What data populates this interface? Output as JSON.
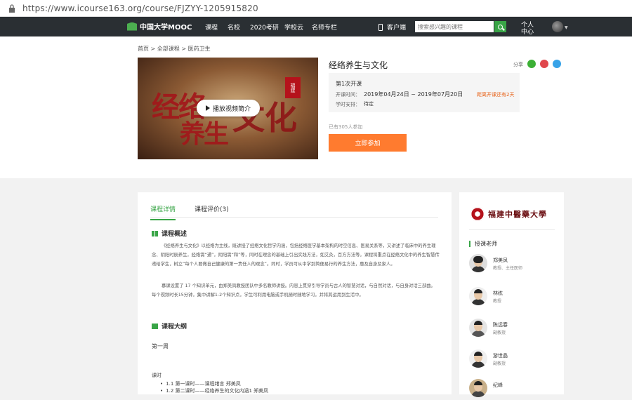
{
  "browser": {
    "url": "https://www.icourse163.org/course/FJZYY-1205915820"
  },
  "topnav": {
    "logo_text": "中国大学MOOC",
    "links": [
      "课程",
      "名校",
      "2020考研",
      "学校云",
      "名师专栏"
    ],
    "client_label": "客户端",
    "search_placeholder": "搜索感兴趣的课程",
    "personal_center": "个人中心"
  },
  "breadcrumb": {
    "items": [
      "首页",
      "全部课程",
      "医药卫生"
    ],
    "separator": ">"
  },
  "course": {
    "title": "经络养生与文化",
    "share_label": "分享",
    "play_label": "播放视频简介",
    "cover_calligraphy_1": "经络",
    "cover_calligraphy_2": "养生",
    "cover_calligraphy_3": "文化",
    "cover_seal": "福建",
    "term": "第1次开课",
    "open_time_label": "开课时间：",
    "open_time_value": "2019年04月24日 ~ 2019年07月20日",
    "schedule_label": "学时安排：",
    "schedule_value": "待定",
    "countdown": "距离开课还有2天",
    "joined_count": "已有305人参加",
    "join_button": "立即参加"
  },
  "tabs": [
    {
      "label": "课程详情",
      "active": true
    },
    {
      "label": "课程评价(3)",
      "active": false
    }
  ],
  "overview": {
    "heading": "课程概述",
    "para1": "《经络养生与文化》以经络为主线，既讲授了经络文化哲学内涵，包括经络医学基本架构的时空信息、医易关系等，又讲述了临床中的养生理念、阴阳时辰养生，经络需“通”，阴阳需“和”等，同时在理念的基础上引出实践方法，如艾灸，百方方法等。课程将重点在经络文化中的养生智慧传递给学生，树立“每个人要做自己健康的第一责任人的观念”。同时，学员可从中学到简便易行的养生方法，惠及自身及家人。",
    "para2": "慕课设置了 17 个知识单元，由郑美凤教授团队中多名教师讲授。内容上贯穿引导学员与古人的智慧对话，与自然对话，与自身对话三部曲。每个视频时长15分钟，集中讲解1-2个知识点，学生可利用电脑或手机随时随地学习，并将其运用到生活中。"
  },
  "syllabus": {
    "heading": "课程大纲",
    "week": "第一周",
    "lessons_label": "课时",
    "lessons": [
      "1.1 第一课时——课程绪言 郑美凤",
      "1.2 第二课时——经络养生的文化内涵1 郑美凤"
    ]
  },
  "sidebar": {
    "school_name": "福建中醫藥大學",
    "teachers_heading": "授课老师",
    "teachers": [
      {
        "name": "郑美凤",
        "title": "教授、主任医师"
      },
      {
        "name": "林栋",
        "title": "教授"
      },
      {
        "name": "陈远春",
        "title": "副教授"
      },
      {
        "name": "游世晶",
        "title": "副教授"
      },
      {
        "name": "纪峰",
        "title": ""
      }
    ]
  },
  "colors": {
    "accent_green": "#39a547",
    "join_orange": "#ff7b2f",
    "nav_bg": "#2a2f33",
    "countdown_orange": "#e8641b"
  }
}
